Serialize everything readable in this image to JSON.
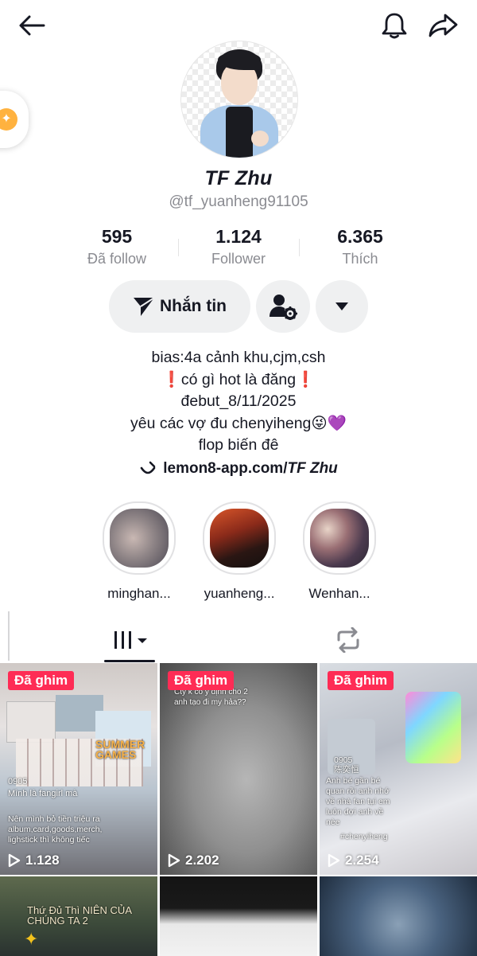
{
  "profile": {
    "display_name": "TF Zhu",
    "username": "@tf_yuanheng91105"
  },
  "stats": [
    {
      "value": "595",
      "label": "Đã follow"
    },
    {
      "value": "1.124",
      "label": "Follower"
    },
    {
      "value": "6.365",
      "label": "Thích"
    }
  ],
  "actions": {
    "message_label": "Nhắn tin"
  },
  "bio": {
    "line1": "bias:4a cảnh khu,cjm,csh",
    "line2": "❗có gì hot là đăng❗",
    "line3": "đebut_8/11/2025",
    "line4": "yêu các vợ đu chenyiheng😜💜",
    "line5": "flop biến đê"
  },
  "link": {
    "prefix": "lemon8-app.com/",
    "name": "TF Zhu"
  },
  "highlights": [
    {
      "name": "minghan..."
    },
    {
      "name": "yuanheng..."
    },
    {
      "name": "Wenhan..."
    }
  ],
  "videos": [
    {
      "pinned_label": "Đã ghim",
      "views": "1.128",
      "caption_a": "0905",
      "caption_b": "Mình là fangirl mà",
      "caption_c": "Nên mình bỏ tiền triệu ra album,card,goods,merch, lighstick thì không tiếc",
      "overlay_text": "SUMMER GAMES"
    },
    {
      "pinned_label": "Đã ghim",
      "views": "2.202",
      "caption_a": "Cty k có ý định cho 2 anh tạo đi my hảa??"
    },
    {
      "pinned_label": "Đã ghim",
      "views": "2.254",
      "caption_a": "0905",
      "caption_b": "陈奕恒",
      "caption_c": "Anh bé gần bé quan rồi anh nhớ về nhà fan tụi em luôn đợi anh về nèe",
      "caption_d": "#chenyiheng"
    },
    {
      "overlay_text": "Thứ Đủ Thì NIÊN CỦA CHÚNG TA 2"
    }
  ],
  "icons": {
    "back": "arrow-left-icon",
    "bell": "bell-icon",
    "share": "share-arrow-icon",
    "send": "send-icon",
    "friend_settings": "user-gear-icon",
    "dropdown": "caret-down-icon",
    "link": "link-smile-icon",
    "grid": "grid-bars-icon",
    "repost": "repost-icon",
    "play": "play-icon"
  },
  "colors": {
    "accent_pin": "#fe2c55",
    "text_primary": "#161823",
    "text_secondary": "#8a8b91",
    "button_bg": "#eff0f1"
  }
}
